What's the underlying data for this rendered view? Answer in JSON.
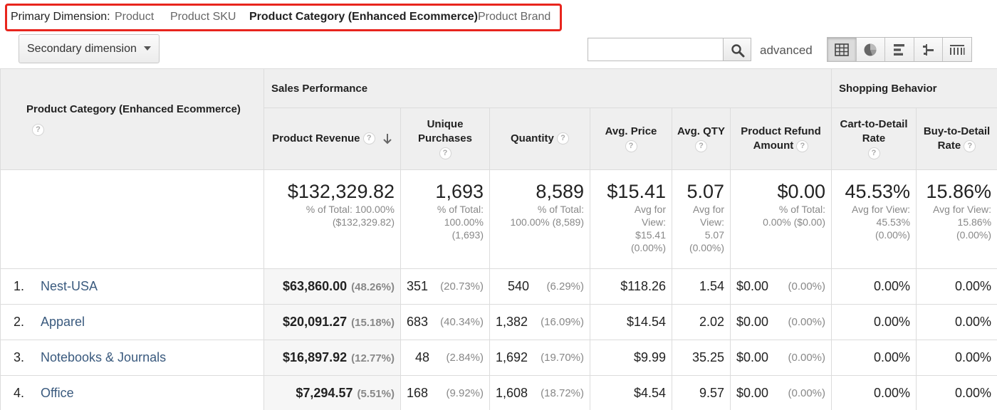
{
  "primary_dimension": {
    "label": "Primary Dimension:",
    "options": [
      "Product",
      "Product SKU",
      "Product Category (Enhanced Ecommerce)",
      "Product Brand"
    ],
    "active": "Product Category (Enhanced Ecommerce)"
  },
  "toolbar": {
    "secondary_dimension_label": "Secondary dimension",
    "search_value": "",
    "advanced_label": "advanced",
    "view_buttons": [
      "data-table-icon",
      "pie-chart-icon",
      "performance-bars-icon",
      "comparison-icon",
      "term-cloud-icon"
    ],
    "active_view": "data-table-icon"
  },
  "table": {
    "dimension_header": "Product Category (Enhanced Ecommerce)",
    "groups": [
      "Sales Performance",
      "Shopping Behavior"
    ],
    "metrics": {
      "revenue": "Product Revenue",
      "unique_purchases": "Unique Purchases",
      "quantity": "Quantity",
      "avg_price": "Avg. Price",
      "avg_qty": "Avg. QTY",
      "refund": "Product Refund Amount",
      "cart_to_detail": "Cart-to-Detail Rate",
      "buy_to_detail": "Buy-to-Detail Rate"
    },
    "help_glyph": "?",
    "totals": {
      "revenue": {
        "value": "$132,329.82",
        "sub1": "% of Total: 100.00%",
        "sub2": "($132,329.82)"
      },
      "unique_purchases": {
        "value": "1,693",
        "sub1": "% of Total:",
        "sub2": "100.00%",
        "sub3": "(1,693)"
      },
      "quantity": {
        "value": "8,589",
        "sub1": "% of Total:",
        "sub2": "100.00% (8,589)"
      },
      "avg_price": {
        "value": "$15.41",
        "sub1": "Avg for",
        "sub2": "View:",
        "sub3": "$15.41",
        "sub4": "(0.00%)"
      },
      "avg_qty": {
        "value": "5.07",
        "sub1": "Avg for",
        "sub2": "View:",
        "sub3": "5.07",
        "sub4": "(0.00%)"
      },
      "refund": {
        "value": "$0.00",
        "sub1": "% of Total:",
        "sub2": "0.00% ($0.00)"
      },
      "cart_to_detail": {
        "value": "45.53%",
        "sub1": "Avg for View:",
        "sub2": "45.53%",
        "sub3": "(0.00%)"
      },
      "buy_to_detail": {
        "value": "15.86%",
        "sub1": "Avg for View:",
        "sub2": "15.86%",
        "sub3": "(0.00%)"
      }
    },
    "rows": [
      {
        "idx": "1.",
        "name": "Nest-USA",
        "revenue": "$63,860.00",
        "revenue_pct": "(48.26%)",
        "unique": "351",
        "unique_pct": "(20.73%)",
        "qty": "540",
        "qty_pct": "(6.29%)",
        "avg_price": "$118.26",
        "avg_qty": "1.54",
        "refund": "$0.00",
        "refund_pct": "(0.00%)",
        "cart": "0.00%",
        "buy": "0.00%"
      },
      {
        "idx": "2.",
        "name": "Apparel",
        "revenue": "$20,091.27",
        "revenue_pct": "(15.18%)",
        "unique": "683",
        "unique_pct": "(40.34%)",
        "qty": "1,382",
        "qty_pct": "(16.09%)",
        "avg_price": "$14.54",
        "avg_qty": "2.02",
        "refund": "$0.00",
        "refund_pct": "(0.00%)",
        "cart": "0.00%",
        "buy": "0.00%"
      },
      {
        "idx": "3.",
        "name": "Notebooks & Journals",
        "revenue": "$16,897.92",
        "revenue_pct": "(12.77%)",
        "unique": "48",
        "unique_pct": "(2.84%)",
        "qty": "1,692",
        "qty_pct": "(19.70%)",
        "avg_price": "$9.99",
        "avg_qty": "35.25",
        "refund": "$0.00",
        "refund_pct": "(0.00%)",
        "cart": "0.00%",
        "buy": "0.00%"
      },
      {
        "idx": "4.",
        "name": "Office",
        "revenue": "$7,294.57",
        "revenue_pct": "(5.51%)",
        "unique": "168",
        "unique_pct": "(9.92%)",
        "qty": "1,608",
        "qty_pct": "(18.72%)",
        "avg_price": "$4.54",
        "avg_qty": "9.57",
        "refund": "$0.00",
        "refund_pct": "(0.00%)",
        "cart": "0.00%",
        "buy": "0.00%"
      }
    ]
  },
  "colors": {
    "highlight_border": "#e8251d",
    "header_bg": "#efefef",
    "link": "#3a5a7e"
  }
}
